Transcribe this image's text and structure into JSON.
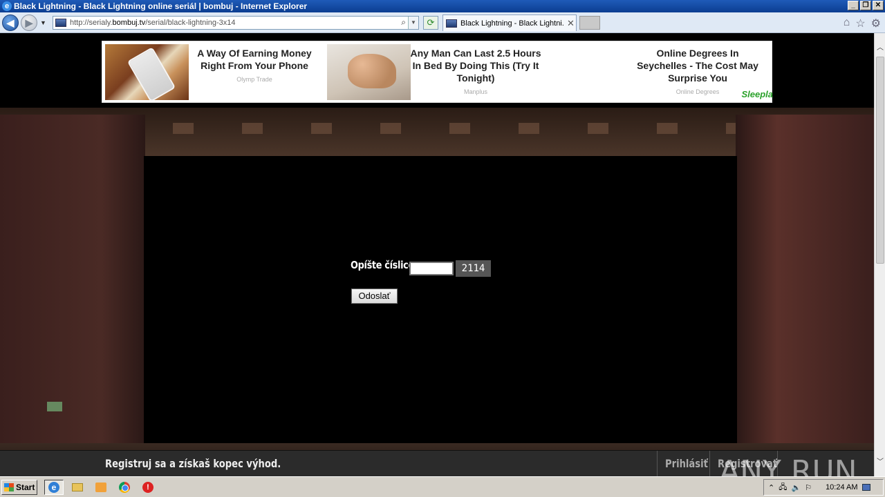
{
  "window": {
    "title": "Black Lightning - Black Lightning online seriál | bombuj - Internet Explorer",
    "minimize_label": "_",
    "restore_label": "❐",
    "close_label": "✕"
  },
  "browser": {
    "url_prefix": "http://serialy.",
    "url_host": "bombuj.tv",
    "url_path": "/serial/black-lightning-3x14",
    "tab_label": "Black Lightning - Black Lightni...",
    "tab_close": "✕"
  },
  "ads": [
    {
      "title": "A Way Of Earning Money Right From Your Phone",
      "source": "Olymp Trade"
    },
    {
      "title": "Any Man Can Last 2.5 Hours In Bed By Doing This (Try It Tonight)",
      "source": "Manplus"
    },
    {
      "title": "Online Degrees In Seychelles - The Cost May Surprise You",
      "source": "Online Degrees",
      "logo": "Sleepla"
    }
  ],
  "captcha": {
    "label": "Opíšte číslice:",
    "input_value": "",
    "code": "2114",
    "submit_label": "Odoslať"
  },
  "sitebar": {
    "promo": "Registruj sa a získaš kopec výhod.",
    "login": "Prihlásiť",
    "register": "Registrovať"
  },
  "watermark": "ANY RUN",
  "taskbar": {
    "start_label": "Start",
    "clock": "10:24 AM"
  }
}
